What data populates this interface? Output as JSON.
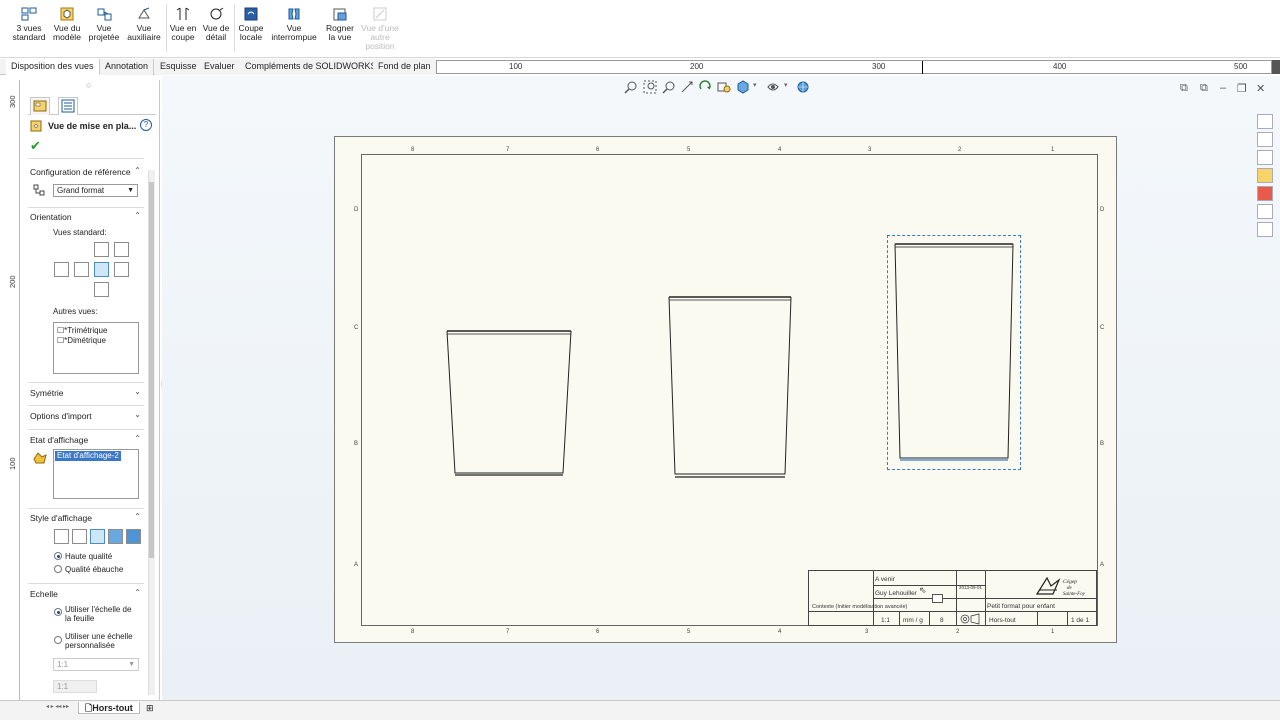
{
  "ribbon": {
    "buttons": [
      {
        "line1": "3 vues",
        "line2": "standard"
      },
      {
        "line1": "Vue du",
        "line2": "modèle"
      },
      {
        "line1": "Vue",
        "line2": "projetée"
      },
      {
        "line1": "Vue",
        "line2": "auxiliaire"
      },
      {
        "line1": "Vue en",
        "line2": "coupe"
      },
      {
        "line1": "Vue de",
        "line2": "détail"
      },
      {
        "line1": "Coupe",
        "line2": "locale"
      },
      {
        "line1": "Vue",
        "line2": "interrompue"
      },
      {
        "line1": "Rogner",
        "line2": "la vue"
      },
      {
        "line1": "Vue d'une",
        "line2": "autre",
        "line3": "position"
      }
    ]
  },
  "tabs": [
    "Disposition des vues",
    "Annotation",
    "Esquisse",
    "Evaluer",
    "Compléments de SOLIDWORKS",
    "Fond de plan"
  ],
  "ruler_top": [
    "100",
    "200",
    "300",
    "400",
    "500"
  ],
  "ruler_left": [
    "300",
    "200",
    "100"
  ],
  "pm": {
    "title": "Vue de mise en pla...",
    "help": "?",
    "config_heading": "Configuration de référence",
    "config_value": "Grand format",
    "orientation_heading": "Orientation",
    "standard_views_label": "Vues standard:",
    "other_views_label": "Autres vues:",
    "other_views": [
      "*Trimétrique",
      "*Dimétrique"
    ],
    "symmetry_heading": "Symétrie",
    "import_heading": "Options d'import",
    "display_state_heading": "Etat d'affichage",
    "display_state_item": "Etat d'affichage-2",
    "display_style_heading": "Style d'affichage",
    "quality_high": "Haute qualité",
    "quality_draft": "Qualité ébauche",
    "scale_heading": "Echelle",
    "scale_sheet": "Utiliser l'échelle de la feuille",
    "scale_custom": "Utiliser une échelle personnalisée",
    "scale_select": "1:1",
    "scale_input": "1:1"
  },
  "sheet": {
    "top_zones": [
      "8",
      "7",
      "6",
      "5",
      "4",
      "3",
      "2",
      "1"
    ],
    "side_zones": [
      "D",
      "C",
      "B",
      "A"
    ]
  },
  "title_block": {
    "project_value": "A venir",
    "author_value": "Guy Lehouiller",
    "title_value": "Petit format pour enfant",
    "description_value": "Contexte (Initier modélisation avancée)",
    "scale_value": "1:1",
    "unit_value": "mm / g",
    "sheet_value": "1 de 1",
    "hors_tout_value": "Hors-tout",
    "rev_value": "8",
    "logo_text": "Cégep de Sainte-Foy",
    "date_value": "2013-09-01"
  },
  "bottom": {
    "sheet_tab": "Hors-tout"
  }
}
